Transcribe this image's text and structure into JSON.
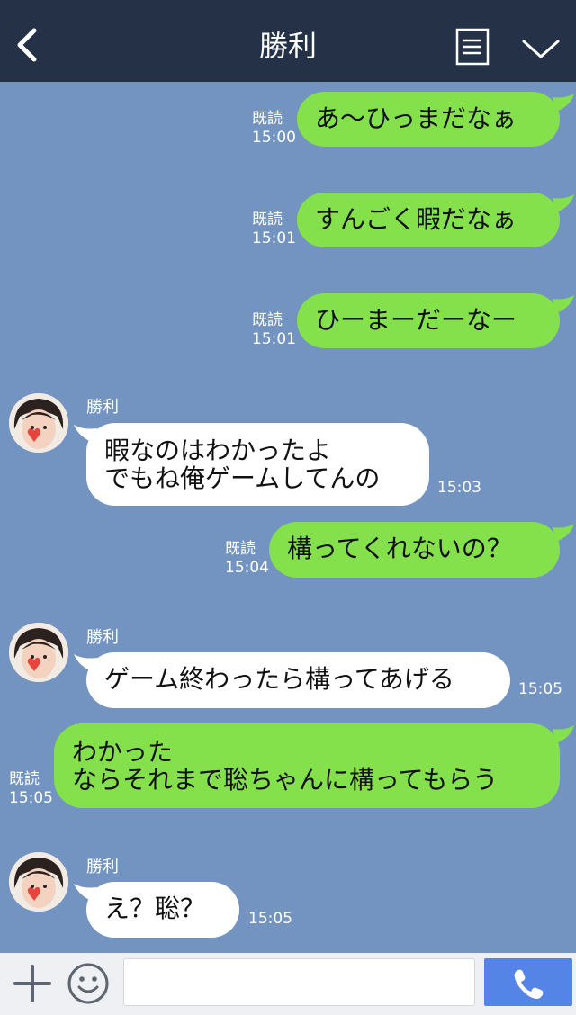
{
  "header": {
    "title": "勝利",
    "back_icon": "chevron-left-icon",
    "menu_icon": "list-icon",
    "collapse_icon": "chevron-down-icon",
    "bg": "#243147"
  },
  "chat": {
    "bg": "#7393c1",
    "outgoing_color": "#84e14c",
    "incoming_color": "#ffffff",
    "messages": [
      {
        "from": "me",
        "text": "あ〜ひっまだなぁ",
        "read": "既読",
        "time": "15:00"
      },
      {
        "from": "me",
        "text": "すんごく暇だなぁ",
        "read": "既読",
        "time": "15:01"
      },
      {
        "from": "me",
        "text": "ひーまーだーなー",
        "read": "既読",
        "time": "15:01"
      },
      {
        "from": "other",
        "sender": "勝利",
        "text": "暇なのはわかったよ\nでもね俺ゲームしてんの",
        "time": "15:03"
      },
      {
        "from": "me",
        "text": "構ってくれないの？",
        "read": "既読",
        "time": "15:04"
      },
      {
        "from": "other",
        "sender": "勝利",
        "text": "ゲーム終わったら構ってあげる",
        "time": "15:05"
      },
      {
        "from": "me",
        "text": "わかった\nならそれまで聡ちゃんに構ってもらう",
        "read": "既読",
        "time": "15:05"
      },
      {
        "from": "other",
        "sender": "勝利",
        "text": "え？聡？",
        "time": "15:05"
      }
    ]
  },
  "composer": {
    "plus_icon": "plus-icon",
    "emoji_icon": "smiley-icon",
    "input_value": "",
    "call_icon": "phone-icon",
    "call_color": "#5384e6"
  }
}
